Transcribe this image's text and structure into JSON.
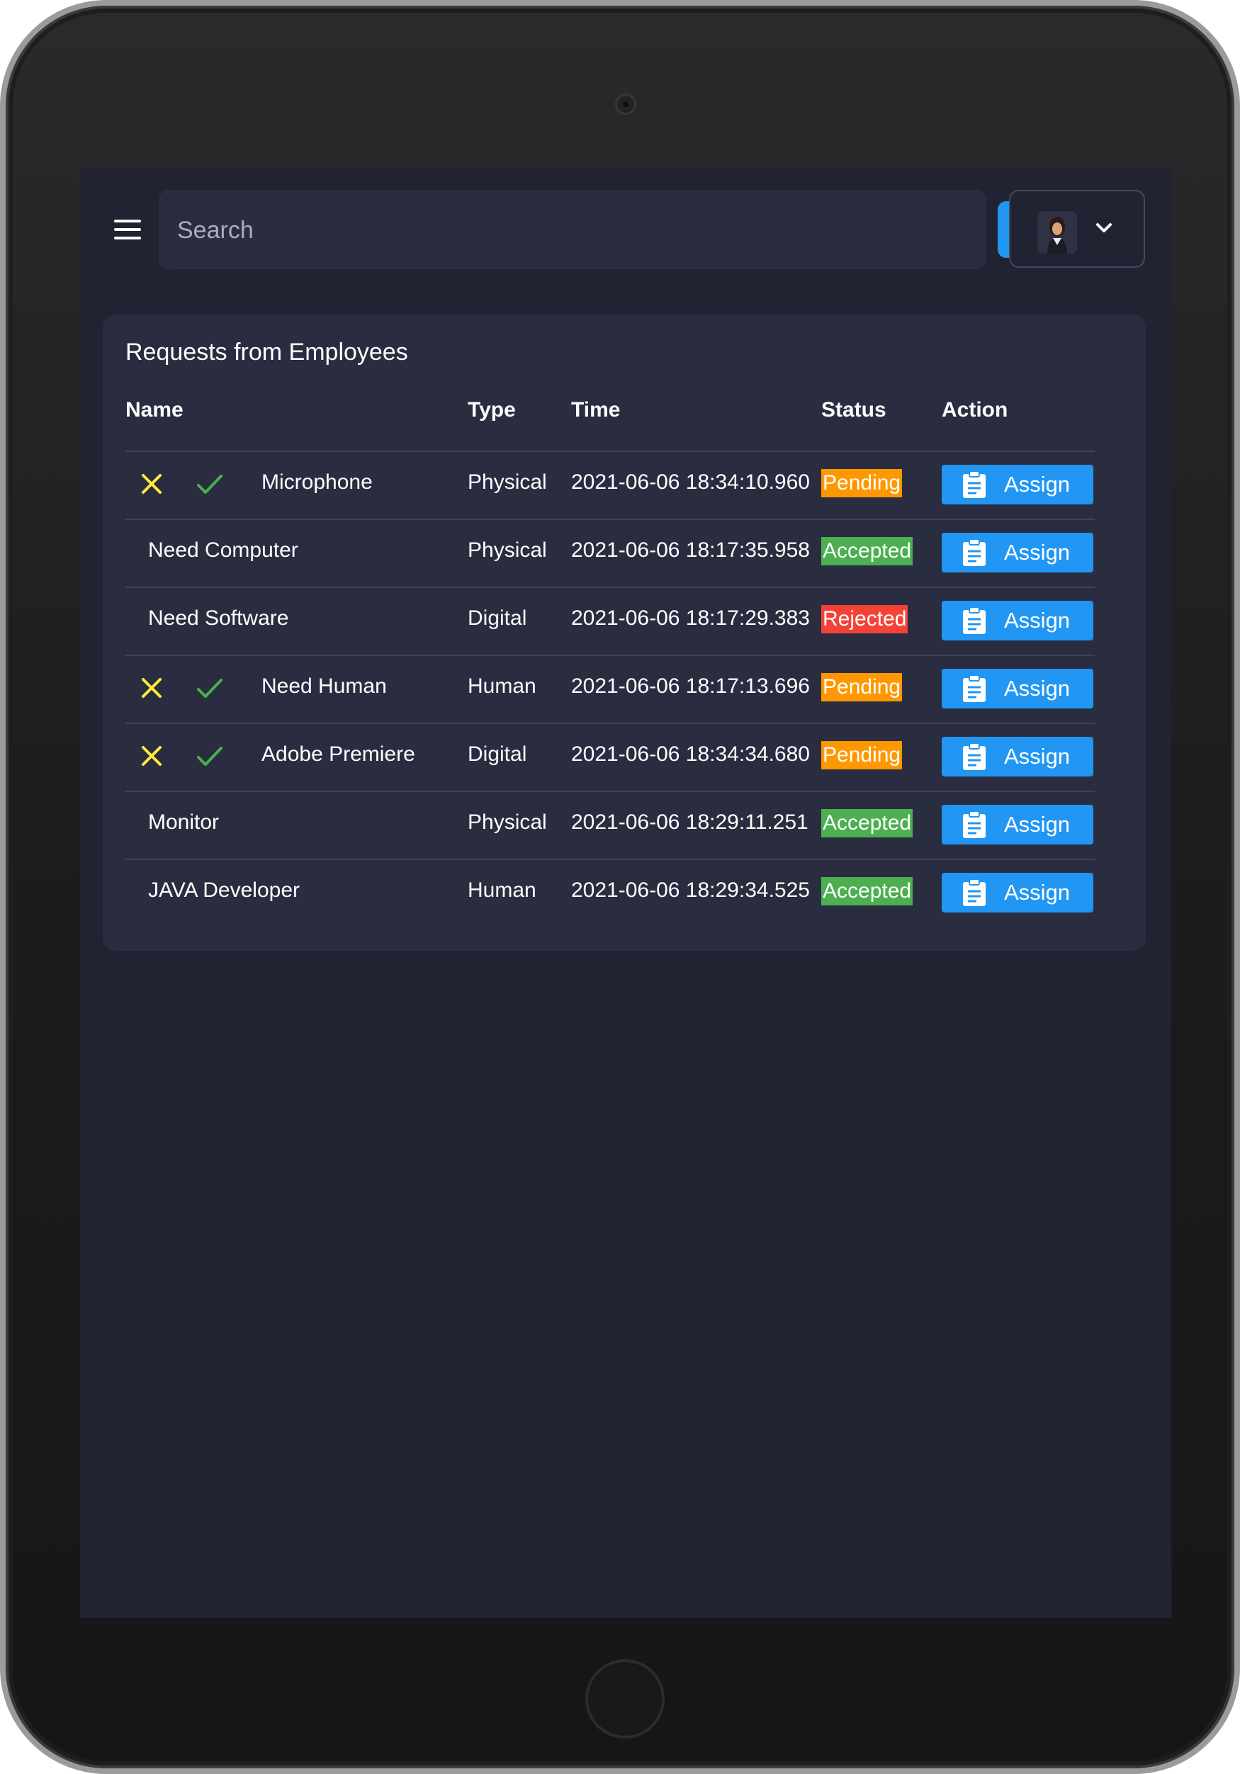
{
  "header": {
    "search": {
      "placeholder": "Search"
    }
  },
  "card": {
    "title": "Requests from Employees",
    "columns": [
      "Name",
      "Type",
      "Time",
      "Status",
      "Action"
    ]
  },
  "status_colors": {
    "Pending": "#ff9800",
    "Accepted": "#4caf50",
    "Rejected": "#f44336"
  },
  "accent": "#2196f3",
  "requests": [
    {
      "name": "Microphone",
      "type": "Physical",
      "time": "2021-06-06 18:34:10.960",
      "status": "Pending",
      "action": "Assign",
      "has_decision_icons": true
    },
    {
      "name": "Need Computer",
      "type": "Physical",
      "time": "2021-06-06 18:17:35.958",
      "status": "Accepted",
      "action": "Assign",
      "has_decision_icons": false
    },
    {
      "name": "Need Software",
      "type": "Digital",
      "time": "2021-06-06 18:17:29.383",
      "status": "Rejected",
      "action": "Assign",
      "has_decision_icons": false
    },
    {
      "name": "Need Human",
      "type": "Human",
      "time": "2021-06-06 18:17:13.696",
      "status": "Pending",
      "action": "Assign",
      "has_decision_icons": true
    },
    {
      "name": "Adobe Premiere",
      "type": "Digital",
      "time": "2021-06-06 18:34:34.680",
      "status": "Pending",
      "action": "Assign",
      "has_decision_icons": true
    },
    {
      "name": "Monitor",
      "type": "Physical",
      "time": "2021-06-06 18:29:11.251",
      "status": "Accepted",
      "action": "Assign",
      "has_decision_icons": false
    },
    {
      "name": "JAVA Developer",
      "type": "Human",
      "time": "2021-06-06 18:29:34.525",
      "status": "Accepted",
      "action": "Assign",
      "has_decision_icons": false
    }
  ],
  "icons": {
    "menu": "hamburger-menu-icon",
    "search": "search-icon",
    "profile_dropdown": "chevron-down-icon",
    "reject": "close-icon",
    "approve": "check-icon",
    "assign": "clipboard-icon"
  }
}
